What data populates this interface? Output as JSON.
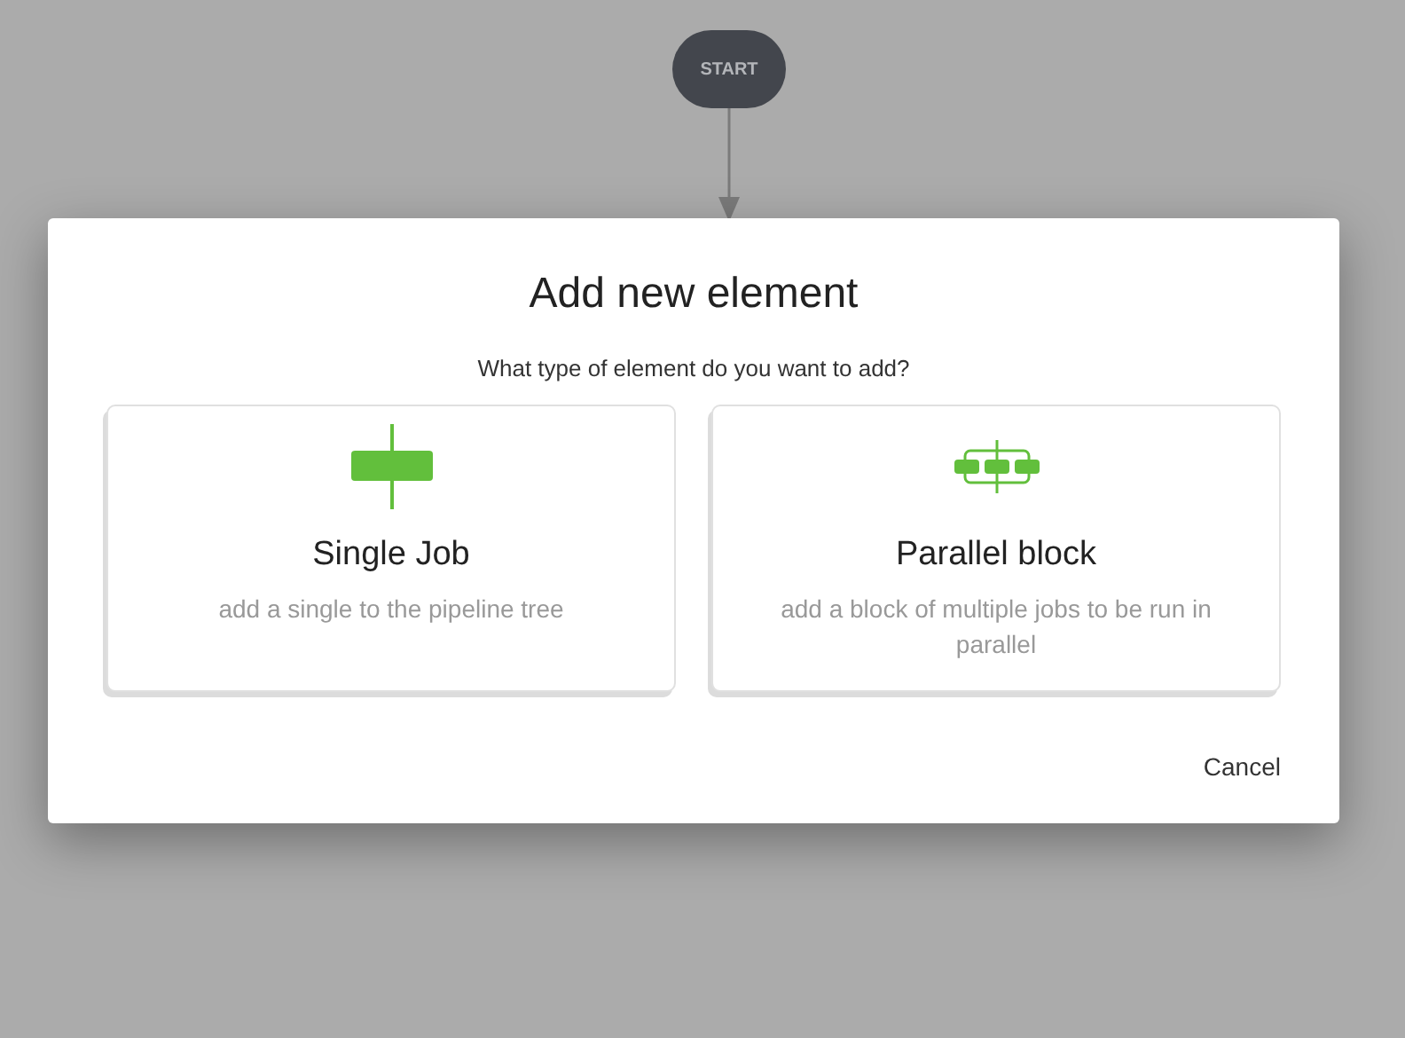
{
  "canvas": {
    "start_node": "START"
  },
  "dialog": {
    "title": "Add new element",
    "question": "What type of element do you want to add?",
    "options": [
      {
        "kind": "single",
        "title": "Single Job",
        "description": "add a single to the pipeline tree"
      },
      {
        "kind": "parallel",
        "title": "Parallel block",
        "description": "add a block of multiple jobs to be run in parallel"
      }
    ],
    "cancel": "Cancel"
  }
}
